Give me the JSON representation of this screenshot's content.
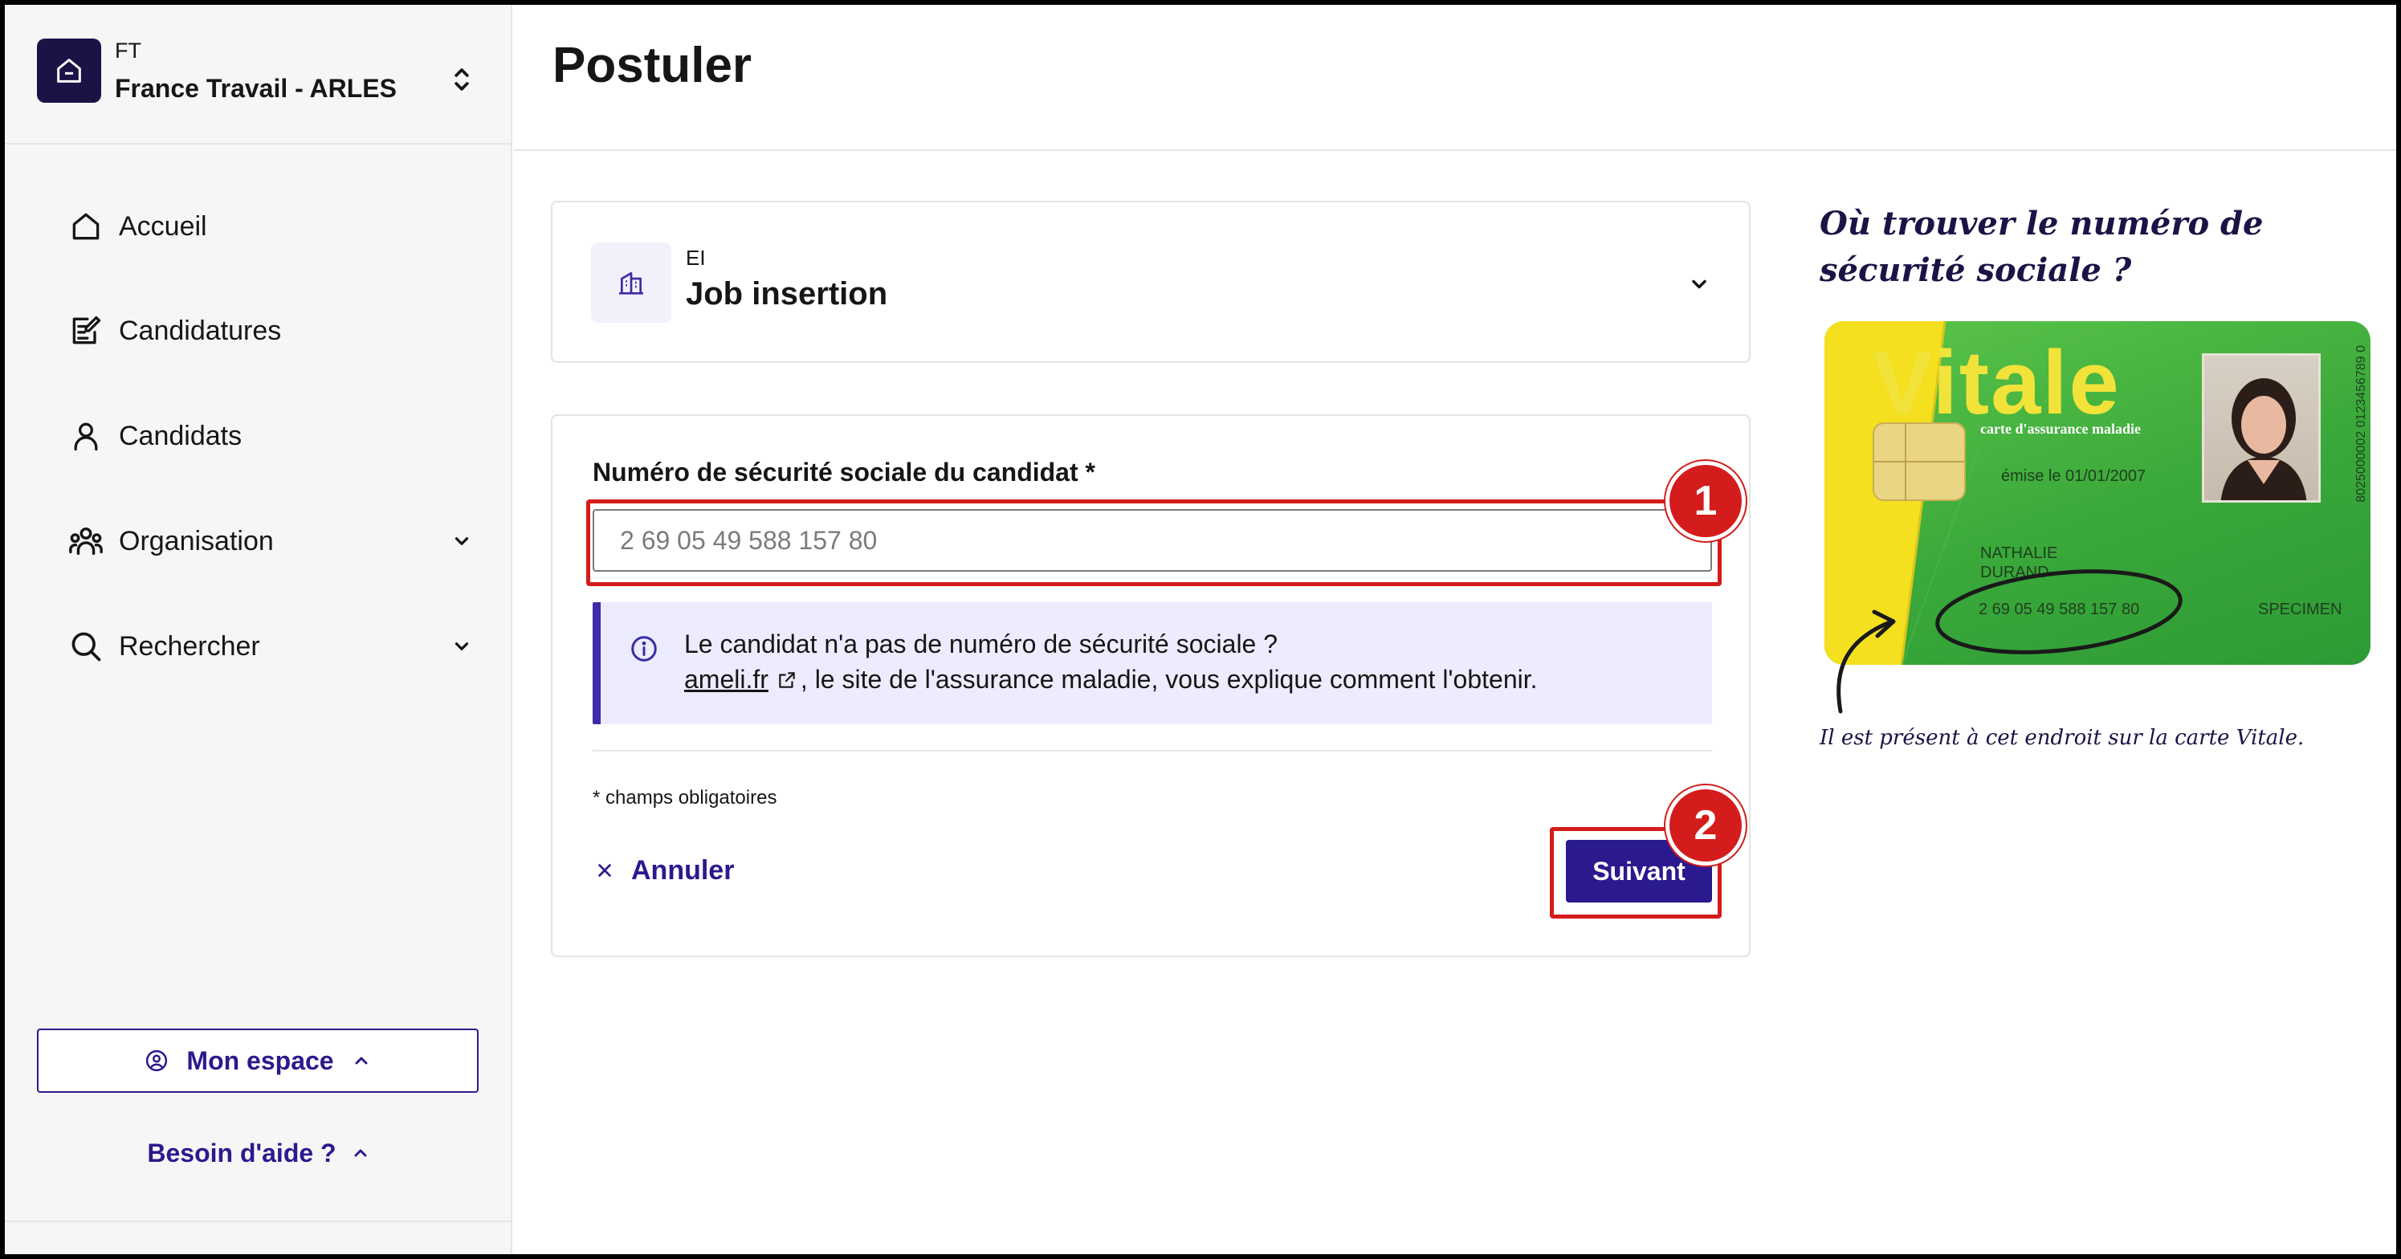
{
  "sidebar": {
    "org_code": "FT",
    "org_name": "France Travail - ARLES",
    "items": [
      {
        "label": "Accueil",
        "icon": "home-icon"
      },
      {
        "label": "Candidatures",
        "icon": "edit-list-icon"
      },
      {
        "label": "Candidats",
        "icon": "user-icon"
      },
      {
        "label": "Organisation",
        "icon": "team-icon",
        "expandable": true
      },
      {
        "label": "Rechercher",
        "icon": "search-icon",
        "expandable": true
      }
    ],
    "mon_espace_label": "Mon espace",
    "help_label": "Besoin d'aide ?"
  },
  "header": {
    "title": "Postuler"
  },
  "structure": {
    "kind": "EI",
    "name": "Job insertion"
  },
  "form": {
    "nir_label": "Numéro de sécurité sociale du candidat *",
    "nir_placeholder": "2 69 05 49 588 157 80",
    "info_line1": "Le candidat n'a pas de numéro de sécurité sociale ?",
    "info_link": "ameli.fr",
    "info_line2_rest": ", le site de l'assurance maladie, vous explique comment l'obtenir.",
    "required_note": "* champs obligatoires",
    "cancel_label": "Annuler",
    "next_label": "Suivant"
  },
  "annotations": {
    "badge_1": "1",
    "badge_2": "2",
    "highlight_color": "#d41c1c"
  },
  "help": {
    "title": "Où trouver le numéro de sécurité sociale ?",
    "caption": "Il est présent à cet endroit sur la carte Vitale.",
    "card": {
      "brand": "Vitale",
      "subtitle": "carte d'assurance maladie",
      "issued": "émise le 01/01/2007",
      "holder_line1": "NATHALIE",
      "holder_line2": "DURAND",
      "number": "2 69 05 49 588 157 80",
      "specimen": "SPECIMEN",
      "serial": "8025000002 0123456789 0"
    }
  },
  "colors": {
    "primary": "#2a1a8e",
    "logo_bg": "#1a1446",
    "info_bg": "#ececfe",
    "info_border": "#3d2ba8"
  }
}
